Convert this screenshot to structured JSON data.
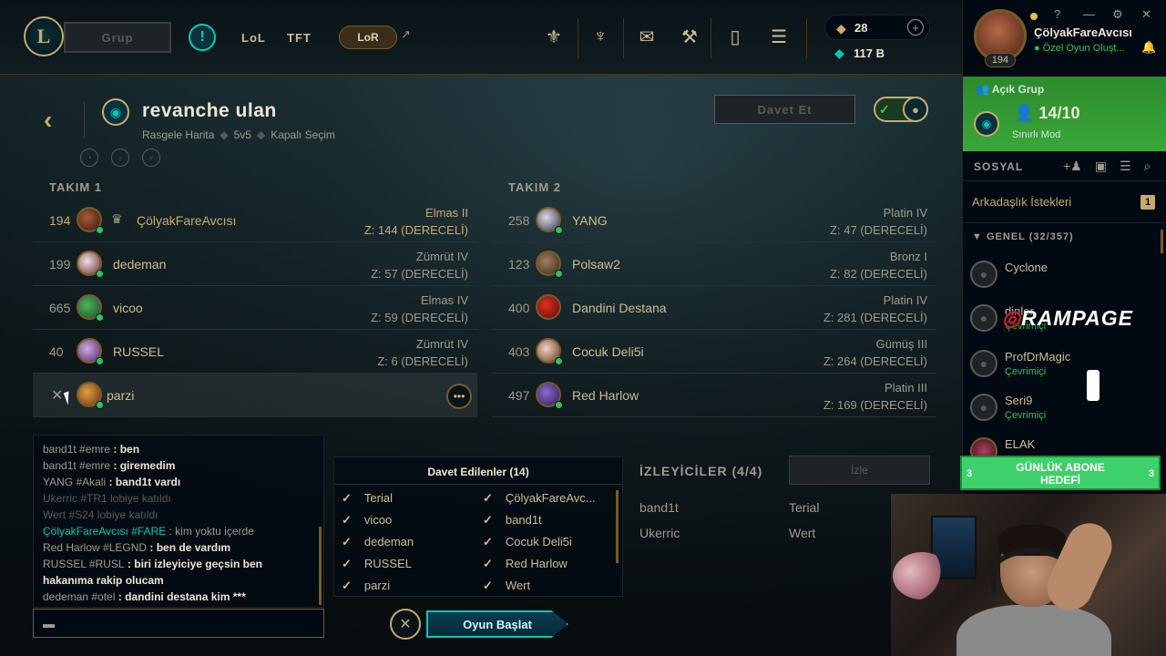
{
  "topbar": {
    "logo": "L",
    "group_button": "Grup",
    "nav": [
      "LoL",
      "TFT"
    ],
    "lor_label": "LoR",
    "icons": [
      "clash-icon",
      "tft-icon",
      "store-chest-icon",
      "crafting-icon",
      "collection-icon",
      "loot-icon"
    ],
    "rp": "28",
    "be": "117 B"
  },
  "lobby": {
    "title": "revanche ulan",
    "map": "Rasgele Harita",
    "size": "5v5",
    "mode": "Kapalı Seçim",
    "invite_button": "Davet Et"
  },
  "team1": {
    "header": "TAKIM 1",
    "players": [
      {
        "level": "194",
        "name": "ÇölyakFareAvcısı",
        "tier": "Elmas II",
        "lp": "Z: 144 (DERECELİ)"
      },
      {
        "level": "199",
        "name": "dedeman",
        "tier": "Zümrüt IV",
        "lp": "Z: 57 (DERECELİ)"
      },
      {
        "level": "665",
        "name": "vicoo",
        "tier": "Elmas IV",
        "lp": "Z: 59 (DERECELİ)"
      },
      {
        "level": "40",
        "name": "RUSSEL",
        "tier": "Zümrüt IV",
        "lp": "Z: 6 (DERECELİ)"
      },
      {
        "level": "",
        "name": "parzi",
        "tier": "",
        "lp": ""
      }
    ]
  },
  "team2": {
    "header": "TAKIM 2",
    "players": [
      {
        "level": "258",
        "name": "YANG",
        "tier": "Platin IV",
        "lp": "Z: 47 (DERECELİ)"
      },
      {
        "level": "123",
        "name": "Polsaw2",
        "tier": "Bronz I",
        "lp": "Z: 82 (DERECELİ)"
      },
      {
        "level": "400",
        "name": "Dandini Destana",
        "tier": "Platin IV",
        "lp": "Z: 281 (DERECELİ)"
      },
      {
        "level": "403",
        "name": "Cocuk Deli5i",
        "tier": "Gümüş III",
        "lp": "Z: 264 (DERECELİ)"
      },
      {
        "level": "497",
        "name": "Red Harlow",
        "tier": "Platin III",
        "lp": "Z: 169 (DERECELİ)"
      }
    ]
  },
  "chat": {
    "messages": [
      {
        "name": "band1t #emre",
        "text": " : ben"
      },
      {
        "name": "band1t #emre",
        "text": " : giremedim"
      },
      {
        "name": "YANG #Akali",
        "text": " : band1t vardı"
      },
      {
        "system": "Ukerric #TR1 lobiye katıldı"
      },
      {
        "system": "Wert #S24 lobiye katıldı"
      },
      {
        "self": "ÇölyakFareAvcısı #FARE",
        "text": " : kim yoktu içerde"
      },
      {
        "name": "Red Harlow #LEGND",
        "text": " : ben de vardım"
      },
      {
        "name": "RUSSEL #RUSL",
        "text": " : biri izleyiciye geçsin ben"
      },
      {
        "cont": "hakanıma rakip olucam"
      },
      {
        "name": "dedeman #otel",
        "text": " : dandini destana kim ***"
      }
    ]
  },
  "invited": {
    "header": "Davet Edilenler (14)",
    "left": [
      "Terial",
      "vicoo",
      "dedeman",
      "RUSSEL",
      "parzi"
    ],
    "right": [
      "ÇölyakFareAvc...",
      "band1t",
      "Cocuk Deli5i",
      "Red Harlow",
      "Wert"
    ]
  },
  "spectators": {
    "header": "İZLEYİCİLER (4/4)",
    "button": "İzle",
    "names": [
      "band1t",
      "Terial",
      "Ukerric",
      "Wert"
    ]
  },
  "start_button": "Oyun Başlat",
  "profile": {
    "name": "ÇölyakFareAvcısı",
    "status": "Özel Oyun Oluşt...",
    "level": "194"
  },
  "group_panel": {
    "header": "Açık Grup",
    "count": "14/10",
    "mode": "Sınırlı Mod"
  },
  "social": {
    "header": "SOSYAL",
    "friend_requests": "Arkadaşlık İstekleri",
    "friend_requests_count": "1",
    "general": "GENEL (32/357)",
    "friends": [
      {
        "name": "Cyclone",
        "status": ""
      },
      {
        "name": "dinler",
        "status": "Çevrimiçi"
      },
      {
        "name": "ProfDrMagic",
        "status": "Çevrimiçi"
      },
      {
        "name": "Seri9",
        "status": "Çevrimiçi"
      },
      {
        "name": "ELAK",
        "status": ""
      }
    ]
  },
  "overlay": {
    "rampage": "RAMPAGE",
    "goal_title": "GÜNLÜK ABONE",
    "goal_sub": "HEDEFİ",
    "goal_left": "3",
    "goal_right": "3"
  }
}
